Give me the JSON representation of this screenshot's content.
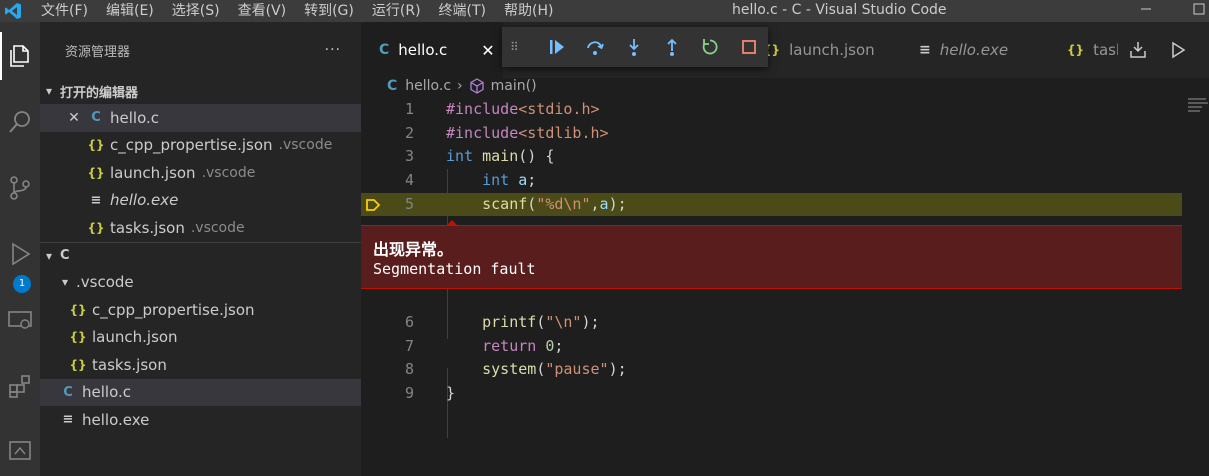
{
  "titlebar": {
    "menu": [
      "文件(F)",
      "编辑(E)",
      "选择(S)",
      "查看(V)",
      "转到(G)",
      "运行(R)",
      "终端(T)",
      "帮助(H)"
    ],
    "window_title": "hello.c - C - Visual Studio Code"
  },
  "activity_bar": {
    "items": [
      "explorer-icon",
      "search-icon",
      "source-control-icon",
      "run-debug-icon",
      "remote-explorer-icon",
      "extensions-icon",
      "panel-icon"
    ],
    "debug_badge": "1"
  },
  "sidebar": {
    "title": "资源管理器",
    "more": "···",
    "open_editors": {
      "title": "打开的编辑器",
      "items": [
        {
          "icon": "C",
          "name": "hello.c",
          "desc": ""
        },
        {
          "icon": "{}",
          "name": "c_cpp_propertise.json",
          "desc": ".vscode"
        },
        {
          "icon": "{}",
          "name": "launch.json",
          "desc": ".vscode"
        },
        {
          "icon": "≡",
          "name": "hello.exe",
          "desc": ""
        },
        {
          "icon": "{}",
          "name": "tasks.json",
          "desc": ".vscode"
        }
      ]
    },
    "folder": {
      "title": "C",
      "subfolder": ".vscode",
      "sub_items": [
        "c_cpp_propertise.json",
        "launch.json",
        "tasks.json"
      ],
      "items": [
        "hello.c",
        "hello.exe"
      ]
    }
  },
  "tabs": [
    {
      "icon": "C",
      "label": "hello.c",
      "close": "✕"
    },
    {
      "icon": "{}",
      "label": "launch.json"
    },
    {
      "icon": "≡",
      "label": "hello.exe"
    },
    {
      "icon": "{}",
      "label": "tasks"
    }
  ],
  "breadcrumb": {
    "file": "hello.c",
    "symbol": "main()"
  },
  "code": {
    "line_numbers": [
      "1",
      "2",
      "3",
      "4",
      "5",
      "6",
      "7",
      "8",
      "9"
    ],
    "highlighted_line": "5"
  },
  "exception": {
    "title": "出现异常。",
    "message": "Segmentation fault"
  },
  "colors": {
    "accent": "#007acc",
    "exception_bg": "#5a1d1d",
    "exception_border": "#be1100",
    "current_line": "#4b4b18"
  }
}
